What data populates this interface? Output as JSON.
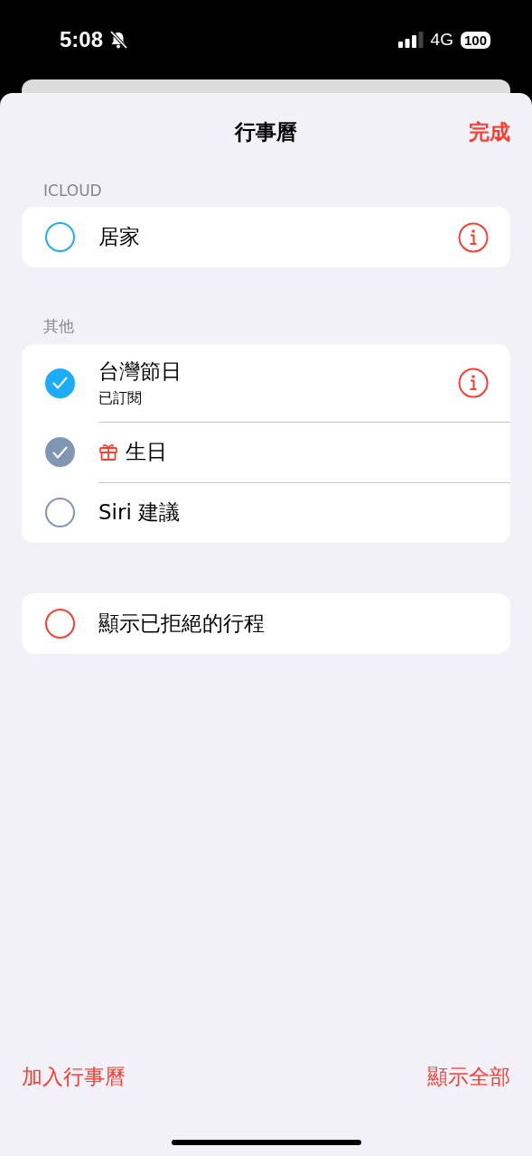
{
  "status_bar": {
    "time": "5:08",
    "silent": true,
    "network": "4G",
    "battery": "100"
  },
  "nav": {
    "title": "行事曆",
    "done": "完成"
  },
  "sections": [
    {
      "header": "ICLOUD",
      "rows": [
        {
          "kind": "plain",
          "title": "居家",
          "checked": false,
          "color": "#1badf8",
          "info": true
        }
      ]
    },
    {
      "header": "其他",
      "rows": [
        {
          "kind": "plain",
          "title": "台灣節日",
          "subtitle": "已訂閱",
          "checked": true,
          "color": "#1badf8",
          "info": true
        },
        {
          "kind": "gift",
          "title": "生日",
          "checked": true,
          "color": "#8097b3",
          "info": false
        },
        {
          "kind": "plain",
          "title": "Siri 建議",
          "checked": false,
          "color": "#8097b3",
          "info": false
        }
      ]
    },
    {
      "rows": [
        {
          "kind": "plain",
          "title": "顯示已拒絕的行程",
          "checked": false,
          "color": "#ff3b30",
          "info": false
        }
      ]
    }
  ],
  "footer": {
    "add": "加入行事曆",
    "show_all": "顯示全部"
  }
}
